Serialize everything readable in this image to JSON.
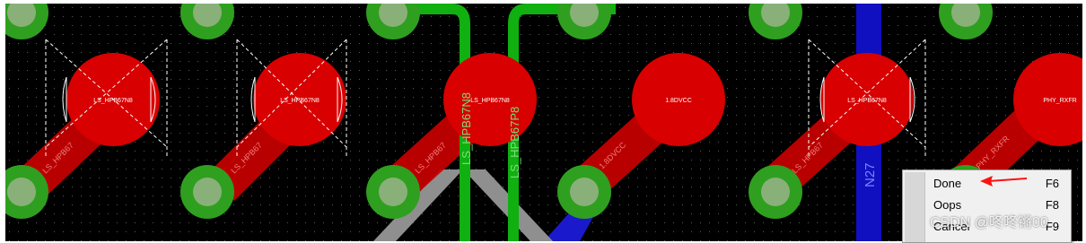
{
  "board": {
    "net_labels": [
      "LS_HPB67N8",
      "LS_HPB67P8",
      "N27"
    ],
    "pad_labels": [
      "LS_HPB67N8",
      "LS_HPB67N8",
      "LS_HPB67N8",
      "1.8DVCC",
      "LS_HPB67N8",
      "PHY_RXFR"
    ],
    "trace_labels": [
      "LS_HPB67",
      "LS_HPB67",
      "LS_HPB67",
      "1.8DVCC",
      "LS_HPB67",
      "PHY_RXFR"
    ],
    "colors": {
      "background": "#000000",
      "pad": "#d40000",
      "via": "#2a9a1a",
      "route": "#10c010",
      "blue_trace": "#1010c0",
      "gray_trace": "#9a9a9a"
    }
  },
  "context_menu": {
    "items": [
      {
        "label": "Done",
        "shortcut": "F6"
      },
      {
        "label": "Oops",
        "shortcut": "F8"
      },
      {
        "label": "Cancel",
        "shortcut": "F9"
      }
    ]
  },
  "watermark": "CSDN @咚咚锵00"
}
